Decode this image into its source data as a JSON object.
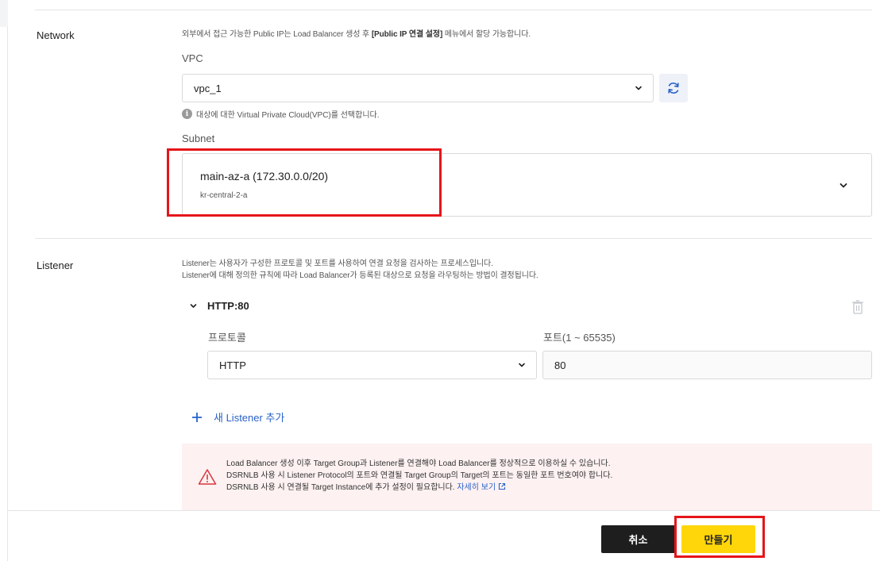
{
  "network": {
    "title": "Network",
    "description_prefix": "외부에서 접근 가능한 Public IP는 Load Balancer 생성 후 ",
    "description_bold": "[Public IP 연결 설정]",
    "description_suffix": " 메뉴에서 할당 가능합니다.",
    "vpc_label": "VPC",
    "vpc_value": "vpc_1",
    "vpc_hint": "대상에 대한 Virtual Private Cloud(VPC)를 선택합니다.",
    "subnet_label": "Subnet",
    "subnet_name": "main-az-a (172.30.0.0/20)",
    "subnet_zone": "kr-central-2-a"
  },
  "listener": {
    "title": "Listener",
    "description_line1": "Listener는 사용자가 구성한 프로토콜 및 포트를 사용하여 연결 요청을 검사하는 프로세스입니다.",
    "description_line2": "Listener에 대해 정의한 규칙에 따라 Load Balancer가 등록된 대상으로 요청을 라우팅하는 방법이 결정됩니다.",
    "item_name": "HTTP:80",
    "protocol_label": "프로토콜",
    "protocol_value": "HTTP",
    "port_label": "포트(1 ~ 65535)",
    "port_value": "80",
    "add_label": "새 Listener 추가"
  },
  "warning": {
    "line1": "Load Balancer 생성 이후 Target Group과 Listener를 연결해야 Load Balancer를 정상적으로 이용하실 수 있습니다.",
    "line2": "DSRNLB 사용 시 Listener Protocol의 포트와 연결될 Target Group의 Target의 포트는 동일한 포트 번호여야 합니다.",
    "line3": "DSRNLB 사용 시 연결될 Target Instance에 추가 설정이 필요합니다. ",
    "link": "자세히 보기"
  },
  "footer": {
    "cancel_label": "취소",
    "create_label": "만들기"
  },
  "colors": {
    "primary_yellow": "#ffd60a",
    "dark_button": "#1e1e1e",
    "link_blue": "#2962c9",
    "highlight_red": "#e5151a",
    "warning_bg": "#fdf1f1",
    "warning_icon": "#d9363e"
  },
  "icons": {
    "refresh": "refresh-icon",
    "info": "info-icon",
    "chevron": "chevron-down-icon",
    "trash": "trash-icon",
    "plus": "plus-icon",
    "warning": "warning-triangle-icon",
    "external": "external-link-icon"
  }
}
